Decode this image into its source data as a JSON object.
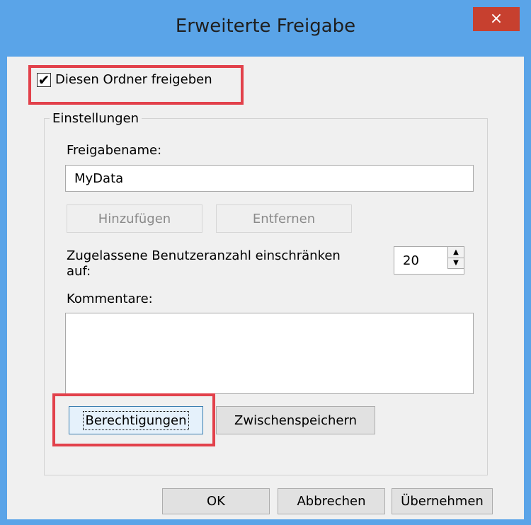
{
  "window": {
    "title": "Erweiterte Freigabe",
    "close_label": "×"
  },
  "share": {
    "checkbox_label": "Diesen Ordner freigeben",
    "checked_mark": "✔"
  },
  "settings": {
    "group_label": "Einstellungen",
    "share_name_label": "Freigabename:",
    "share_name_value": "MyData",
    "add_label": "Hinzufügen",
    "remove_label": "Entfernen",
    "user_limit_label_line1": "Zugelassene Benutzeranzahl einschränken",
    "user_limit_label_line2": "auf:",
    "user_limit_value": "20",
    "comments_label": "Kommentare:",
    "comments_value": "",
    "permissions_label": "Berechtigungen",
    "caching_label": "Zwischenspeichern"
  },
  "footer": {
    "ok_label": "OK",
    "cancel_label": "Abbrechen",
    "apply_label": "Übernehmen"
  },
  "colors": {
    "titlebar": "#5aa4e8",
    "close": "#c7402f",
    "highlight": "#e2414b",
    "dialog_bg": "#f0f0f0"
  }
}
